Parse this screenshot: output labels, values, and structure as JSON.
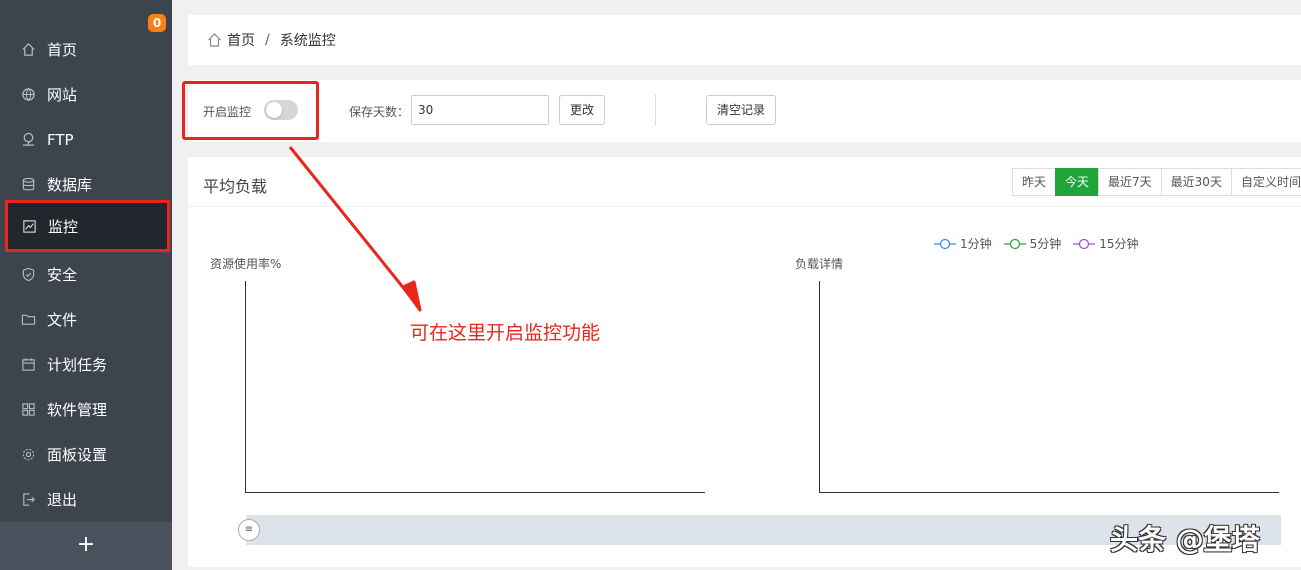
{
  "sidebar": {
    "badge": "0",
    "items": [
      {
        "label": "首页",
        "icon": "home-icon"
      },
      {
        "label": "网站",
        "icon": "globe-icon"
      },
      {
        "label": "FTP",
        "icon": "ftp-icon"
      },
      {
        "label": "数据库",
        "icon": "database-icon"
      },
      {
        "label": "监控",
        "icon": "monitor-icon"
      },
      {
        "label": "安全",
        "icon": "shield-icon"
      },
      {
        "label": "文件",
        "icon": "folder-icon"
      },
      {
        "label": "计划任务",
        "icon": "calendar-icon"
      },
      {
        "label": "软件管理",
        "icon": "grid-icon"
      },
      {
        "label": "面板设置",
        "icon": "gear-icon"
      },
      {
        "label": "退出",
        "icon": "logout-icon"
      }
    ],
    "add_label": "+"
  },
  "breadcrumb": {
    "home": "首页",
    "separator": "/",
    "current": "系统监控"
  },
  "toolbar": {
    "monitor_toggle_label": "开启监控",
    "monitor_enabled": false,
    "save_days_label": "保存天数：",
    "save_days_value": "30",
    "change_button": "更改",
    "clear_button": "清空记录"
  },
  "chart_panel": {
    "title": "平均负载",
    "ranges": [
      "昨天",
      "今天",
      "最近7天",
      "最近30天",
      "自定义时间"
    ],
    "active_range": "今天"
  },
  "chart_data": [
    {
      "type": "line",
      "title": "",
      "ylabel": "资源使用率%",
      "xlabel": "",
      "series": []
    },
    {
      "type": "line",
      "title": "",
      "ylabel": "负载详情",
      "xlabel": "",
      "legend": [
        {
          "name": "1分钟",
          "color": "#2d8cf0"
        },
        {
          "name": "5分钟",
          "color": "#20a53a"
        },
        {
          "name": "15分钟",
          "color": "#a24ae8"
        }
      ],
      "series": []
    }
  ],
  "annotation": {
    "text": "可在这里开启监控功能",
    "color": "#e8261c"
  },
  "watermark": "头条 @堡塔",
  "colors": {
    "sidebar_bg": "#3c444d",
    "sidebar_active": "#22272e",
    "accent_green": "#20a53a",
    "badge_orange": "#ff7f17",
    "annotation_red": "#e8261c"
  }
}
